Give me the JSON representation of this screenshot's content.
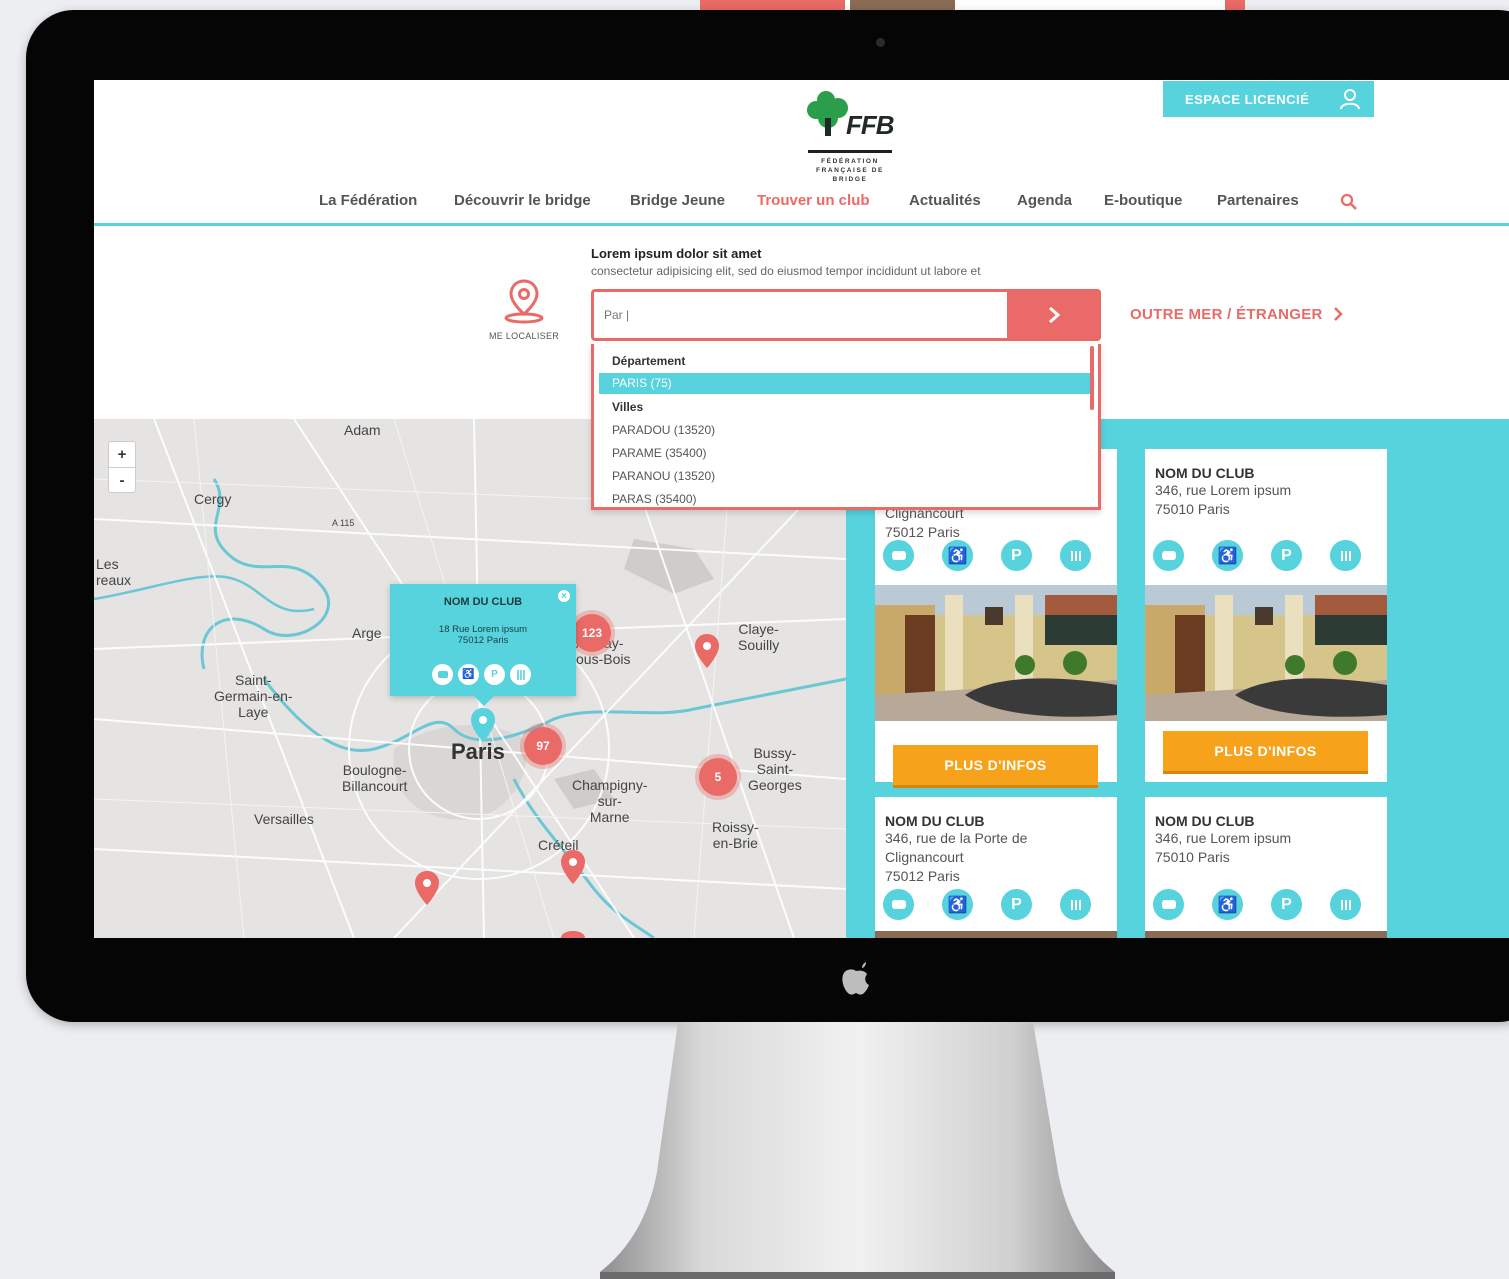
{
  "header": {
    "logo_text": "FFB",
    "logo_sub": "FÉDÉRATION FRANÇAISE DE BRIDGE",
    "espace_label": "ESPACE LICENCIÉ"
  },
  "nav": {
    "items": [
      {
        "label": "La Fédération"
      },
      {
        "label": "Découvrir le bridge"
      },
      {
        "label": "Bridge Jeune"
      },
      {
        "label": "Trouver un club"
      },
      {
        "label": "Actualités"
      },
      {
        "label": "Agenda"
      },
      {
        "label": "E-boutique"
      },
      {
        "label": "Partenaires"
      }
    ],
    "active": "Trouver un club"
  },
  "search": {
    "title": "Lorem ipsum dolor sit amet",
    "subtitle": "consectetur adipisicing elit, sed do eiusmod tempor incididunt ut labore et",
    "value": "Par |",
    "locate_label": "ME LOCALISER",
    "outremer_label": "OUTRE MER / ÉTRANGER"
  },
  "dropdown": {
    "group1": "Département",
    "selected": "PARIS (75)",
    "group2": "Villes",
    "items": [
      "PARADOU (13520)",
      "PARAME (35400)",
      "PARANOU (13520)",
      "PARAS (35400)"
    ]
  },
  "map": {
    "zoom_in": "+",
    "zoom_out": "-",
    "places": {
      "adam": "Adam",
      "cergy": "Cergy",
      "a115": "A 115",
      "les_reaux": "Les\nreaux",
      "argenteuil": "Arge",
      "saint_germain": "Saint-\nGermain-en-\nLaye",
      "paris": "Paris",
      "boulogne": "Boulogne-\nBillancourt",
      "versailles": "Versailles",
      "aulnay": "Aulnay-\nous-Bois",
      "claye": "Claye-\nSouilly",
      "champigny": "Champigny-\nsur-\nMarne",
      "creteil": "Créteil",
      "bussy": "Bussy-\nSaint-\nGeorges",
      "roissy": "Roissy-\nen-Brie"
    },
    "clusters": [
      "123",
      "97",
      "5"
    ],
    "popup": {
      "title": "NOM DU CLUB",
      "address": "18 Rue Lorem ipsum\n75012 Paris",
      "close": "×",
      "icons": [
        "♿",
        "P"
      ]
    }
  },
  "clubs": [
    {
      "name": "",
      "address": "Clignancourt\n75012 Paris",
      "button": "PLUS D'INFOS"
    },
    {
      "name": "NOM DU CLUB",
      "address": "346, rue Lorem ipsum\n75010 Paris",
      "button": "PLUS D'INFOS"
    },
    {
      "name": "NOM DU CLUB",
      "address": "346, rue de la Porte de\nClignancourt\n75012 Paris",
      "button": ""
    },
    {
      "name": "NOM DU CLUB",
      "address": "346, rue Lorem ipsum\n75010 Paris",
      "button": ""
    }
  ],
  "card_icons": [
    "♿",
    "P"
  ],
  "colors": {
    "accent": "#56d3dd",
    "primary": "#e96a66",
    "button": "#f7a21b",
    "logo_green": "#2a9e4a"
  }
}
